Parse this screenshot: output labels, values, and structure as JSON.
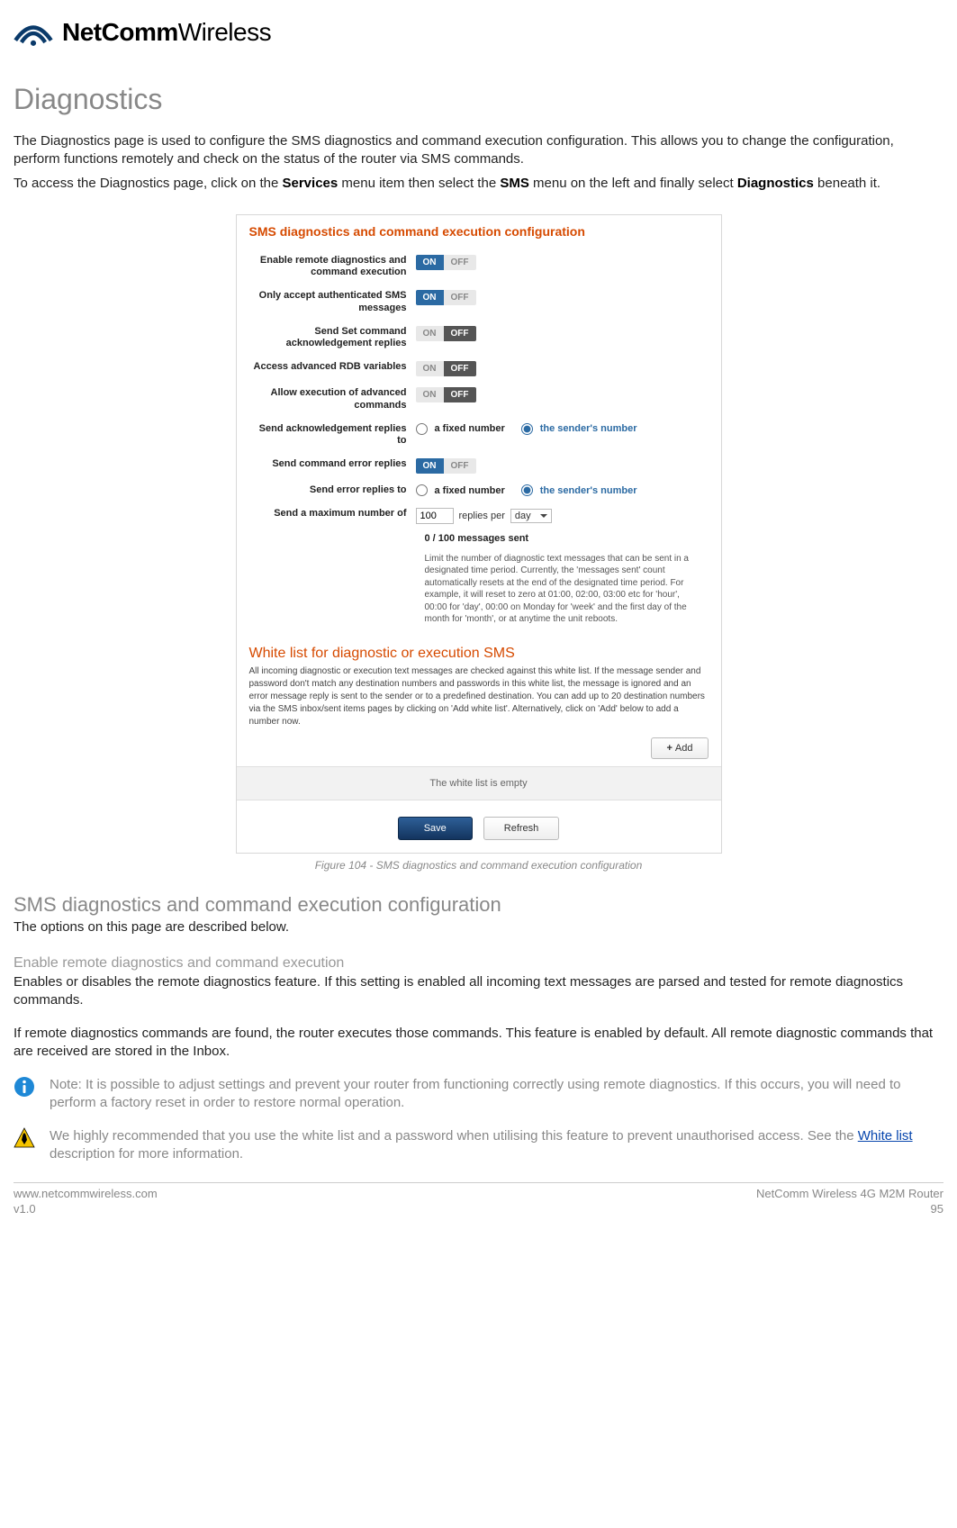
{
  "logo": {
    "bold": "NetComm",
    "light": "Wireless"
  },
  "page": {
    "title": "Diagnostics",
    "intro1": "The Diagnostics page is used to configure the SMS diagnostics and command execution configuration. This allows you to change the configuration, perform functions remotely and check on the status of the router via SMS commands.",
    "intro2_a": "To access the Diagnostics page, click on the ",
    "intro2_b": "Services",
    "intro2_c": " menu item then select the ",
    "intro2_d": "SMS",
    "intro2_e": " menu on the left and finally select ",
    "intro2_f": "Diagnostics",
    "intro2_g": " beneath it."
  },
  "panel": {
    "title": "SMS diagnostics and command execution configuration",
    "rows": {
      "enable": {
        "label": "Enable remote diagnostics and command execution",
        "on": "ON",
        "off": "OFF"
      },
      "authonly": {
        "label": "Only accept authenticated SMS messages",
        "on": "ON",
        "off": "OFF"
      },
      "sendset": {
        "label": "Send Set command acknowledgement replies",
        "on": "ON",
        "off": "OFF"
      },
      "advrdb": {
        "label": "Access advanced RDB variables",
        "on": "ON",
        "off": "OFF"
      },
      "advcmd": {
        "label": "Allow execution of advanced commands",
        "on": "ON",
        "off": "OFF"
      },
      "ackto": {
        "label": "Send acknowledgement replies to",
        "opt1": "a fixed number",
        "opt2": "the sender's number"
      },
      "errreply": {
        "label": "Send command error replies",
        "on": "ON",
        "off": "OFF"
      },
      "errto": {
        "label": "Send error replies to",
        "opt1": "a fixed number",
        "opt2": "the sender's number"
      },
      "maxnum": {
        "label": "Send a maximum number of",
        "val": "100",
        "per": "replies per",
        "unit": "day"
      }
    },
    "sent_count": "0 / 100 messages sent",
    "limit_desc": "Limit the number of diagnostic text messages that can be sent in a designated time period. Currently, the 'messages sent' count automatically resets at the end of the designated time period. For example, it will reset to zero at 01:00, 02:00, 03:00 etc for 'hour', 00:00 for 'day', 00:00 on Monday for 'week' and the first day of the month for 'month', or at anytime the unit reboots.",
    "wl_title": "White list for diagnostic or execution SMS",
    "wl_desc": "All incoming diagnostic or execution text messages are checked against this white list. If the message sender and password don't match any destination numbers and passwords in this white list, the message is ignored and an error message reply is sent to the sender or to a predefined destination. You can add up to 20 destination numbers via the SMS inbox/sent items pages by clicking on 'Add white list'. Alternatively, click on 'Add' below to add a number now.",
    "add": "Add",
    "wl_empty": "The white list is empty",
    "save": "Save",
    "refresh": "Refresh"
  },
  "caption": "Figure 104 - SMS diagnostics and command execution configuration",
  "sections": {
    "h2": "SMS diagnostics and command execution configuration",
    "h2_p": "The options on this page are described below.",
    "h3_enable": "Enable remote diagnostics and command execution",
    "enable_p1": "Enables or disables the remote diagnostics feature. If this setting is enabled all incoming text messages are parsed and tested for remote diagnostics commands.",
    "enable_p2": "If remote diagnostics commands are found, the router executes those commands. This feature is enabled by default. All remote diagnostic commands that are received are stored in the Inbox."
  },
  "notes": {
    "info": "Note: It is possible to adjust settings and prevent your router from functioning correctly using remote diagnostics. If this occurs, you will need to perform a factory reset in order to restore normal operation.",
    "warn_a": "We highly recommended that you use the white list and a password when utilising this feature to prevent unauthorised access. See the ",
    "warn_link": "White list",
    "warn_b": " description for more information."
  },
  "footer": {
    "url": "www.netcommwireless.com",
    "ver": "v1.0",
    "product": "NetComm Wireless 4G M2M Router",
    "page": "95"
  }
}
